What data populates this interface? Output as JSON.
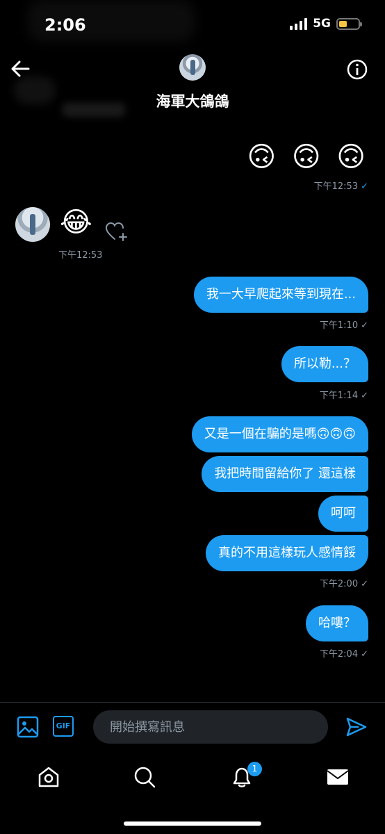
{
  "status_bar": {
    "time": "2:06",
    "network": "5G"
  },
  "header": {
    "contact_name": "海軍大鴿鴿"
  },
  "messages": {
    "sent_emoji": {
      "emojis": [
        "🙃",
        "🙃",
        "🙃"
      ],
      "time": "下午12:53",
      "status": "✓"
    },
    "received": {
      "emoji": "😂",
      "time": "下午12:53"
    },
    "m1": {
      "text": "我一大早爬起來等到現在...",
      "time": "下午1:10",
      "status": "✓"
    },
    "m2": {
      "text": "所以勒...？",
      "time": "下午1:14",
      "status": "✓"
    },
    "group": {
      "items": [
        "又是一個在騙的是嗎🙃🙃🙃",
        "我把時間留給你了 還這樣",
        "呵呵",
        "真的不用這樣玩人感情餒"
      ],
      "time": "下午2:00",
      "status": "✓"
    },
    "m3": {
      "text": "哈嘍？",
      "time": "下午2:04",
      "status": "✓"
    }
  },
  "composer": {
    "placeholder": "開始撰寫訊息",
    "gif_label": "GIF"
  },
  "tabbar": {
    "notification_badge": "1"
  },
  "colors": {
    "accent": "#1d9bf0",
    "background": "#000000",
    "muted": "#8b98a5"
  }
}
